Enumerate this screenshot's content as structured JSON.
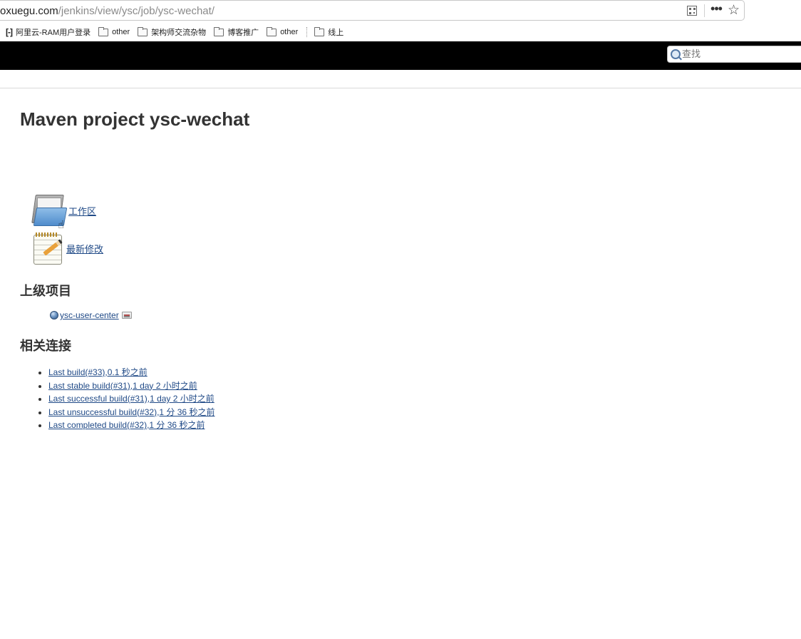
{
  "browser": {
    "url_host": "oxuegu.com",
    "url_path": "/jenkins/view/ysc/job/ysc-wechat/",
    "bookmarks": [
      {
        "label": "阿里云-RAM用户登录",
        "icon": "aliyun-logo"
      },
      {
        "label": "other",
        "icon": "folder-icon"
      },
      {
        "label": "架构师交流杂物",
        "icon": "folder-icon"
      },
      {
        "label": "博客推广",
        "icon": "folder-icon"
      },
      {
        "label": "other",
        "icon": "folder-icon"
      },
      {
        "label": "线上",
        "icon": "folder-icon"
      }
    ],
    "aliyun_logo_text": "[-]"
  },
  "header": {
    "search_placeholder": "查找"
  },
  "main": {
    "title": "Maven project ysc-wechat",
    "tasks": [
      {
        "label": "工作区",
        "icon": "workspace-folder-icon"
      },
      {
        "label": "最新修改",
        "icon": "notepad-icon"
      }
    ],
    "upstream_heading": "上级项目",
    "upstream_project": "ysc-user-center",
    "permalinks_heading": "相关连接",
    "permalinks": [
      "Last build(#33),0.1 秒之前",
      "Last stable build(#31),1 day 2 小时之前",
      "Last successful build(#31),1 day 2 小时之前",
      "Last unsuccessful build(#32),1 分 36 秒之前",
      "Last completed build(#32),1 分 36 秒之前"
    ]
  },
  "colors": {
    "header_bg": "#000000",
    "link": "#204a87",
    "heading": "#333333"
  }
}
